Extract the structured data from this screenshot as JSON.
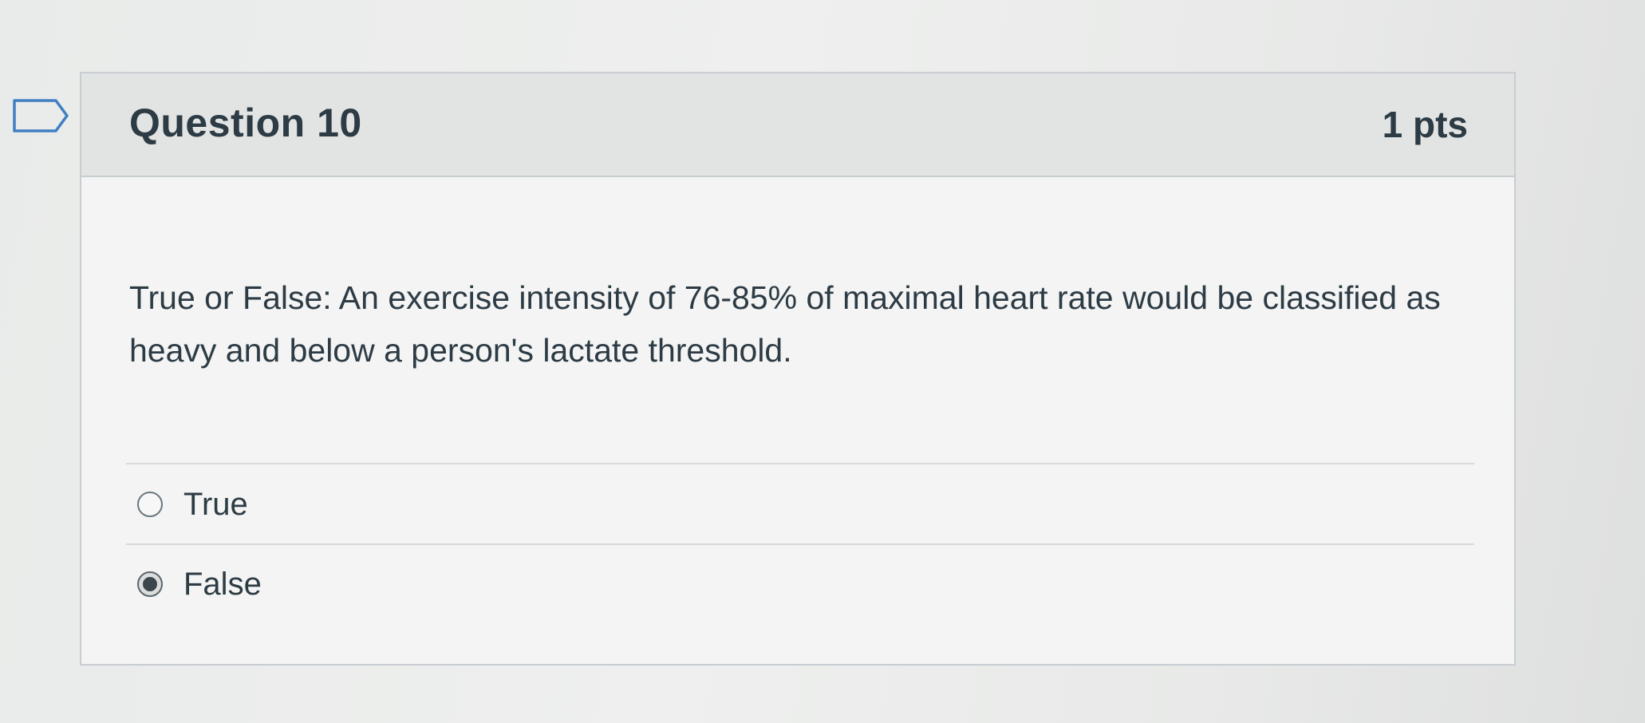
{
  "question": {
    "title": "Question 10",
    "points": "1 pts",
    "text": "True or False: An exercise intensity of 76-85% of maximal heart rate would be classified as heavy and below a person's lactate threshold.",
    "flag_icon": "flag-outline-icon"
  },
  "answers": [
    {
      "label": "True",
      "selected": false
    },
    {
      "label": "False",
      "selected": true
    }
  ],
  "colors": {
    "text": "#2d3b45",
    "header_bg": "#e2e4e3",
    "border": "#c7cdd1"
  }
}
